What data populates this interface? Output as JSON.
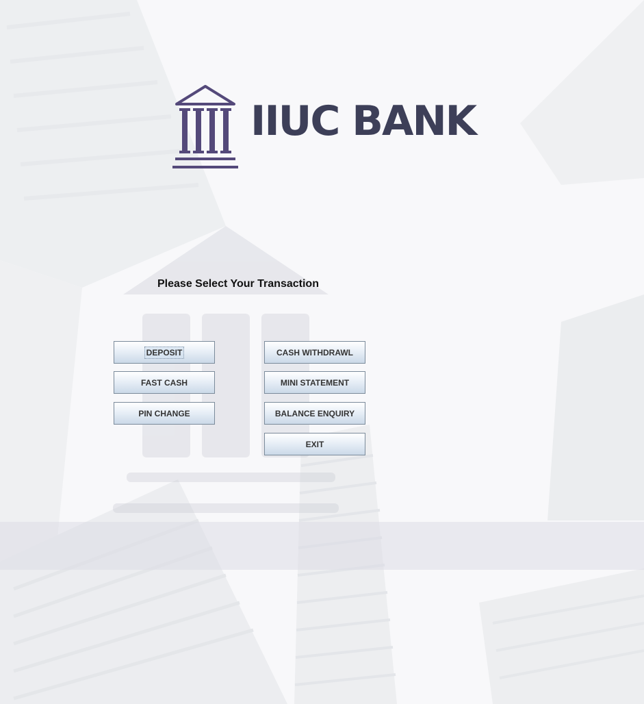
{
  "brand": {
    "name": "IIUC BANK",
    "logo_icon": "bank-pillars-icon",
    "color": "#3d3f58",
    "icon_color": "#54497a"
  },
  "prompt": "Please Select Your Transaction",
  "buttons": {
    "deposit": "DEPOSIT",
    "fast_cash": "FAST CASH",
    "pin_change": "PIN CHANGE",
    "cash_withdrawl": "CASH WITHDRAWL",
    "mini_statement": "MINI STATEMENT",
    "balance_enquiry": "BALANCE ENQUIRY",
    "exit": "EXIT"
  },
  "focused_button": "deposit",
  "background": {
    "description_icon": "city-skyscrapers-background"
  }
}
